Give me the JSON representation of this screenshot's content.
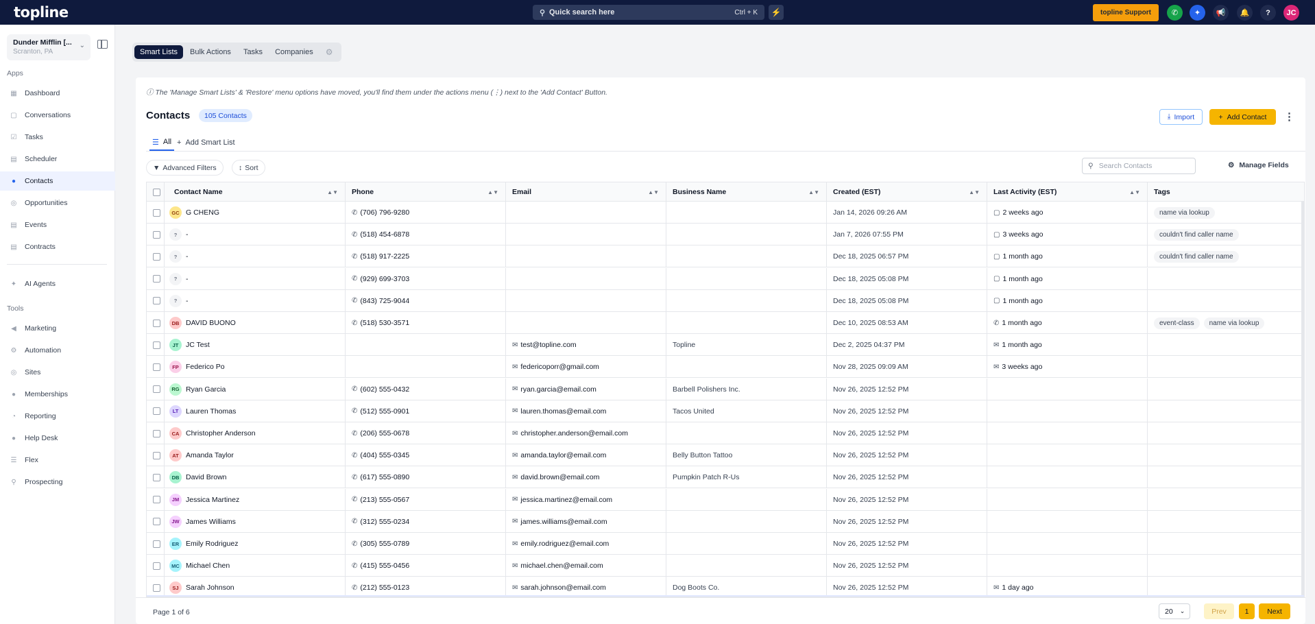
{
  "topbar": {
    "logo": "topline",
    "search_placeholder": "Quick search here",
    "search_shortcut": "Ctrl + K",
    "support_label": "topline Support",
    "user_initials": "JC"
  },
  "sidebar": {
    "location_name": "Dunder Mifflin [...",
    "location_city": "Scranton, PA",
    "apps_label": "Apps",
    "tools_label": "Tools",
    "apps": [
      {
        "label": "Dashboard",
        "icon": "dashboard-icon"
      },
      {
        "label": "Conversations",
        "icon": "chat-icon"
      },
      {
        "label": "Tasks",
        "icon": "tasks-icon"
      },
      {
        "label": "Scheduler",
        "icon": "calendar-icon"
      },
      {
        "label": "Contacts",
        "icon": "person-icon"
      },
      {
        "label": "Opportunities",
        "icon": "target-icon"
      },
      {
        "label": "Events",
        "icon": "calendar-icon"
      },
      {
        "label": "Contracts",
        "icon": "document-icon"
      }
    ],
    "ai_agents": "AI Agents",
    "tools": [
      {
        "label": "Marketing",
        "icon": "megaphone-icon"
      },
      {
        "label": "Automation",
        "icon": "gear-icon"
      },
      {
        "label": "Sites",
        "icon": "globe-icon"
      },
      {
        "label": "Memberships",
        "icon": "users-icon"
      },
      {
        "label": "Reporting",
        "icon": "pie-chart-icon"
      },
      {
        "label": "Help Desk",
        "icon": "help-icon"
      },
      {
        "label": "Flex",
        "icon": "flex-icon"
      },
      {
        "label": "Prospecting",
        "icon": "search-icon"
      }
    ]
  },
  "tabs": [
    "Smart Lists",
    "Bulk Actions",
    "Tasks",
    "Companies"
  ],
  "notice": "The 'Manage Smart Lists' & 'Restore' menu options have moved, you'll find them under the actions menu (⋮) next to the 'Add Contact' Button.",
  "page": {
    "title": "Contacts",
    "count": "105 Contacts",
    "import_label": "Import",
    "add_label": "Add Contact",
    "subtab_all": "All",
    "subtab_add": "Add Smart List",
    "filters_label": "Advanced Filters",
    "sort_label": "Sort",
    "search_placeholder": "Search Contacts",
    "manage_fields": "Manage Fields"
  },
  "columns": [
    "Contact Name",
    "Phone",
    "Email",
    "Business Name",
    "Created (EST)",
    "Last Activity (EST)",
    "Tags"
  ],
  "rows": [
    {
      "initials": "GC",
      "avbg": "#fde68a",
      "avfg": "#92400e",
      "name": "G CHENG",
      "phone": "(706) 796-9280",
      "email": "",
      "business": "",
      "created": "Jan 14, 2026 09:26 AM",
      "activity": "2 weeks ago",
      "activity_icon": "chat",
      "tags": [
        "name via lookup"
      ]
    },
    {
      "initials": "?",
      "avbg": "#f3f4f6",
      "avfg": "#6b7280",
      "name": "-",
      "phone": "(518) 454-6878",
      "email": "",
      "business": "",
      "created": "Jan 7, 2026 07:55 PM",
      "activity": "3 weeks ago",
      "activity_icon": "chat",
      "tags": [
        "couldn't find caller name"
      ]
    },
    {
      "initials": "?",
      "avbg": "#f3f4f6",
      "avfg": "#6b7280",
      "name": "-",
      "phone": "(518) 917-2225",
      "email": "",
      "business": "",
      "created": "Dec 18, 2025 06:57 PM",
      "activity": "1 month ago",
      "activity_icon": "chat",
      "tags": [
        "couldn't find caller name"
      ]
    },
    {
      "initials": "?",
      "avbg": "#f3f4f6",
      "avfg": "#6b7280",
      "name": "-",
      "phone": "(929) 699-3703",
      "email": "",
      "business": "",
      "created": "Dec 18, 2025 05:08 PM",
      "activity": "1 month ago",
      "activity_icon": "chat",
      "tags": []
    },
    {
      "initials": "?",
      "avbg": "#f3f4f6",
      "avfg": "#6b7280",
      "name": "-",
      "phone": "(843) 725-9044",
      "email": "",
      "business": "",
      "created": "Dec 18, 2025 05:08 PM",
      "activity": "1 month ago",
      "activity_icon": "chat",
      "tags": []
    },
    {
      "initials": "DB",
      "avbg": "#fecaca",
      "avfg": "#991b1b",
      "name": "DAVID BUONO",
      "phone": "(518) 530-3571",
      "email": "",
      "business": "",
      "created": "Dec 10, 2025 08:53 AM",
      "activity": "1 month ago",
      "activity_icon": "phone",
      "tags": [
        "event-class",
        "name via lookup"
      ]
    },
    {
      "initials": "JT",
      "avbg": "#a7f3d0",
      "avfg": "#065f46",
      "name": "JC Test",
      "phone": "",
      "email": "test@topline.com",
      "business": "Topline",
      "created": "Dec 2, 2025 04:37 PM",
      "activity": "1 month ago",
      "activity_icon": "mail",
      "tags": []
    },
    {
      "initials": "FP",
      "avbg": "#fbcfe8",
      "avfg": "#9d174d",
      "name": "Federico Po",
      "phone": "",
      "email": "federicoporr@gmail.com",
      "business": "",
      "created": "Nov 28, 2025 09:09 AM",
      "activity": "3 weeks ago",
      "activity_icon": "mail",
      "tags": []
    },
    {
      "initials": "RG",
      "avbg": "#bbf7d0",
      "avfg": "#166534",
      "name": "Ryan Garcia",
      "phone": "(602) 555-0432",
      "email": "ryan.garcia@email.com",
      "business": "Barbell Polishers Inc.",
      "created": "Nov 26, 2025 12:52 PM",
      "activity": "",
      "activity_icon": "",
      "tags": []
    },
    {
      "initials": "LT",
      "avbg": "#ddd6fe",
      "avfg": "#5b21b6",
      "name": "Lauren Thomas",
      "phone": "(512) 555-0901",
      "email": "lauren.thomas@email.com",
      "business": "Tacos United",
      "created": "Nov 26, 2025 12:52 PM",
      "activity": "",
      "activity_icon": "",
      "tags": []
    },
    {
      "initials": "CA",
      "avbg": "#fecaca",
      "avfg": "#991b1b",
      "name": "Christopher Anderson",
      "phone": "(206) 555-0678",
      "email": "christopher.anderson@email.com",
      "business": "",
      "created": "Nov 26, 2025 12:52 PM",
      "activity": "",
      "activity_icon": "",
      "tags": []
    },
    {
      "initials": "AT",
      "avbg": "#fecaca",
      "avfg": "#991b1b",
      "name": "Amanda Taylor",
      "phone": "(404) 555-0345",
      "email": "amanda.taylor@email.com",
      "business": "Belly Button Tattoo",
      "created": "Nov 26, 2025 12:52 PM",
      "activity": "",
      "activity_icon": "",
      "tags": []
    },
    {
      "initials": "DB",
      "avbg": "#a7f3d0",
      "avfg": "#065f46",
      "name": "David Brown",
      "phone": "(617) 555-0890",
      "email": "david.brown@email.com",
      "business": "Pumpkin Patch R-Us",
      "created": "Nov 26, 2025 12:52 PM",
      "activity": "",
      "activity_icon": "",
      "tags": []
    },
    {
      "initials": "JM",
      "avbg": "#f5d0fe",
      "avfg": "#86198f",
      "name": "Jessica Martinez",
      "phone": "(213) 555-0567",
      "email": "jessica.martinez@email.com",
      "business": "",
      "created": "Nov 26, 2025 12:52 PM",
      "activity": "",
      "activity_icon": "",
      "tags": []
    },
    {
      "initials": "JW",
      "avbg": "#f5d0fe",
      "avfg": "#86198f",
      "name": "James Williams",
      "phone": "(312) 555-0234",
      "email": "james.williams@email.com",
      "business": "",
      "created": "Nov 26, 2025 12:52 PM",
      "activity": "",
      "activity_icon": "",
      "tags": []
    },
    {
      "initials": "ER",
      "avbg": "#a5f3fc",
      "avfg": "#155e75",
      "name": "Emily Rodriguez",
      "phone": "(305) 555-0789",
      "email": "emily.rodriguez@email.com",
      "business": "",
      "created": "Nov 26, 2025 12:52 PM",
      "activity": "",
      "activity_icon": "",
      "tags": []
    },
    {
      "initials": "MC",
      "avbg": "#a5f3fc",
      "avfg": "#155e75",
      "name": "Michael Chen",
      "phone": "(415) 555-0456",
      "email": "michael.chen@email.com",
      "business": "",
      "created": "Nov 26, 2025 12:52 PM",
      "activity": "",
      "activity_icon": "",
      "tags": []
    },
    {
      "initials": "SJ",
      "avbg": "#fecaca",
      "avfg": "#991b1b",
      "name": "Sarah Johnson",
      "phone": "(212) 555-0123",
      "email": "sarah.johnson@email.com",
      "business": "Dog Boots Co.",
      "created": "Nov 26, 2025 12:52 PM",
      "activity": "1 day ago",
      "activity_icon": "mail",
      "tags": []
    }
  ],
  "pager": {
    "info": "Page 1 of 6",
    "page_size": "20",
    "prev": "Prev",
    "current": "1",
    "next": "Next"
  },
  "colors": {
    "accent": "#f5b400",
    "navy": "#0f1a3d",
    "link": "#2563eb"
  }
}
